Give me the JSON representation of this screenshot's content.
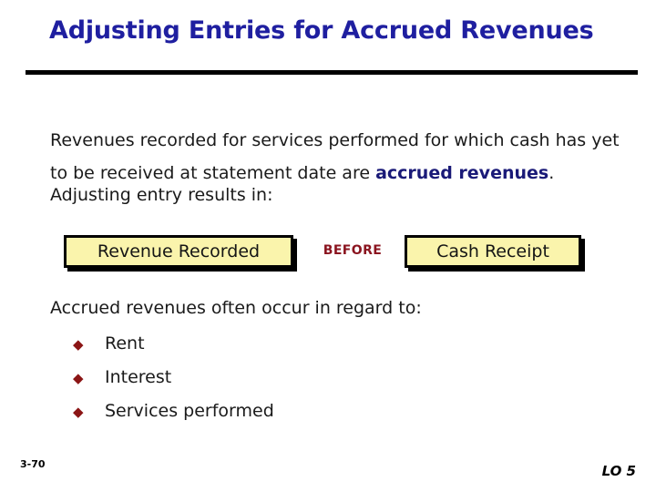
{
  "slide": {
    "title": "Adjusting Entries for Accrued Revenues",
    "intro": {
      "before_term": "Revenues recorded for services performed for which cash has yet to be received at statement date are ",
      "term": "accrued revenues",
      "after_term": "."
    },
    "adjusting_line": "Adjusting entry results in:",
    "flow": {
      "left_box_label": "Revenue Recorded",
      "connector_label": "BEFORE",
      "right_box_label": "Cash Receipt"
    },
    "occurrence_lead": "Accrued revenues often occur in regard to:",
    "bullets": [
      {
        "glyph": "◆",
        "label": "Rent"
      },
      {
        "glyph": "◆",
        "label": "Interest"
      },
      {
        "glyph": "◆",
        "label": "Services performed"
      }
    ],
    "footer": {
      "slide_number": "3-70",
      "learning_objective": "LO 5"
    },
    "colors": {
      "title_blue": "#1f1fa0",
      "term_navy": "#1a1a78",
      "box_yellow": "#faf4ac",
      "connector_red": "#8b1520",
      "bullet_red": "#8b1515",
      "rule_black": "#000000"
    }
  }
}
